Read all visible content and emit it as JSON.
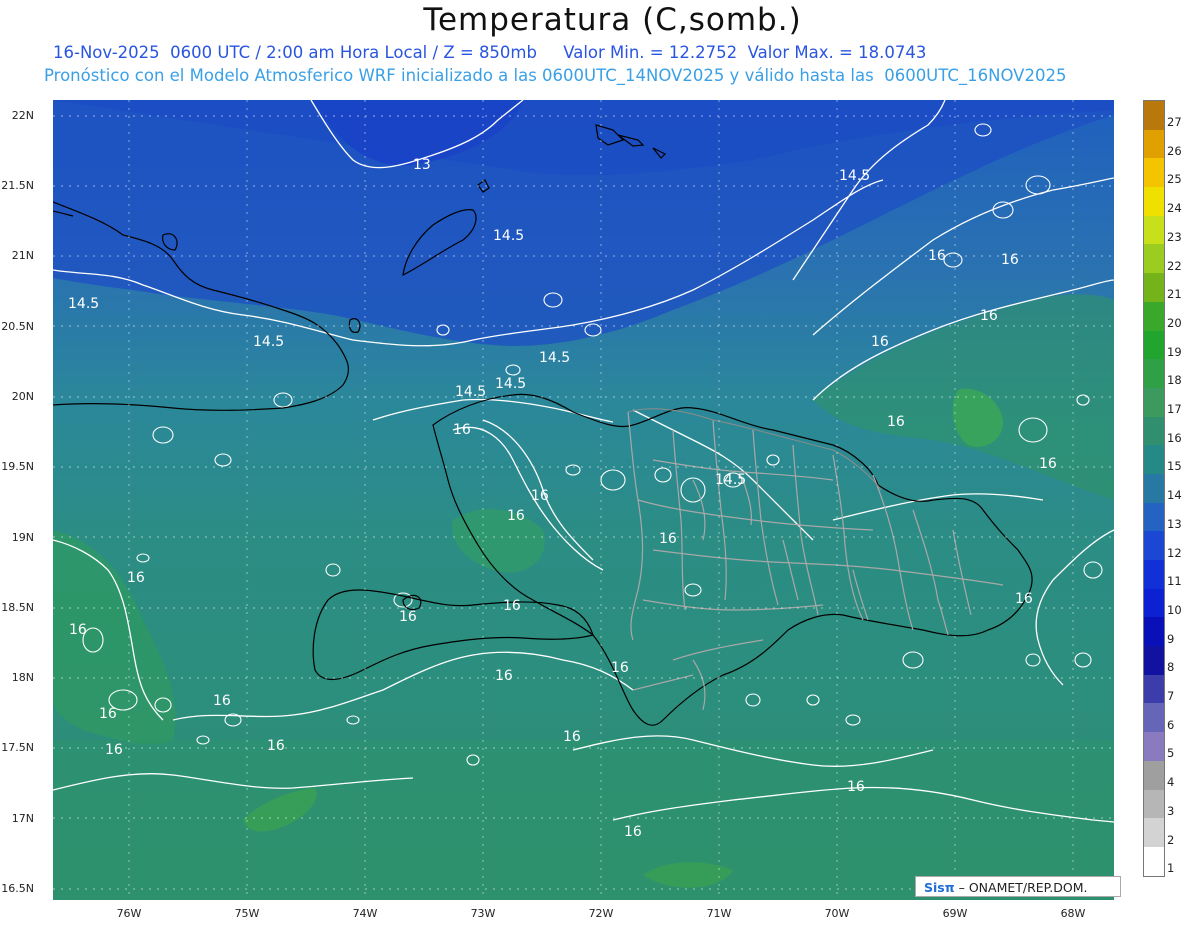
{
  "header": {
    "title": "Temperatura (C,somb.)",
    "line1": "16-Nov-2025  0600 UTC / 2:00 am Hora Local / Z = 850mb     Valor Min. = 12.2752  Valor Max. = 18.0743",
    "line2": "Pronóstico con el Modelo Atmosferico WRF inicializado a las 0600UTC_14NOV2025 y válido hasta las  0600UTC_16NOV2025"
  },
  "axes": {
    "lat_labels": [
      "22N",
      "21.5N",
      "21N",
      "20.5N",
      "20N",
      "19.5N",
      "19N",
      "18.5N",
      "18N",
      "17.5N",
      "17N",
      "16.5N"
    ],
    "lon_labels": [
      "76W",
      "75W",
      "74W",
      "73W",
      "72W",
      "71W",
      "70W",
      "69W",
      "68W"
    ]
  },
  "colorbar": {
    "labels": [
      "27",
      "26",
      "25",
      "24",
      "23",
      "22",
      "21",
      "20",
      "19",
      "18",
      "17",
      "16",
      "15",
      "14",
      "13",
      "12",
      "11",
      "10",
      "9",
      "8",
      "7",
      "6",
      "5",
      "4",
      "3",
      "2",
      "1"
    ],
    "colors": [
      "#b8780c",
      "#e0a000",
      "#f5c400",
      "#f0e000",
      "#c7e01a",
      "#9ccc1f",
      "#74b31a",
      "#3aa82a",
      "#22a52f",
      "#30a046",
      "#3c9a5f",
      "#2f8f6e",
      "#258a85",
      "#2778a2",
      "#2563c2",
      "#1a48d4",
      "#1230d8",
      "#0c22d2",
      "#0a10b8",
      "#1212a0",
      "#3c3caa",
      "#6666b8",
      "#8a7abf",
      "#9f9f9f",
      "#b6b6b6",
      "#d3d3d3",
      "#ffffff"
    ]
  },
  "contour_labels": [
    "13",
    "14.5",
    "14.5",
    "14.5",
    "14.5",
    "14.5",
    "14.5",
    "14.5",
    "14.5",
    "16",
    "16",
    "16",
    "16",
    "16",
    "16",
    "16",
    "16",
    "16",
    "16",
    "16",
    "16",
    "16",
    "16",
    "16",
    "16",
    "16",
    "16",
    "16",
    "16",
    "16",
    "16",
    "16",
    "16"
  ],
  "credit": {
    "brand": "Sisπ",
    "text": "– ONAMET/REP.DOM."
  },
  "colors": {
    "title_line1": "#2a55e0",
    "title_line2": "#3aa0e6"
  }
}
